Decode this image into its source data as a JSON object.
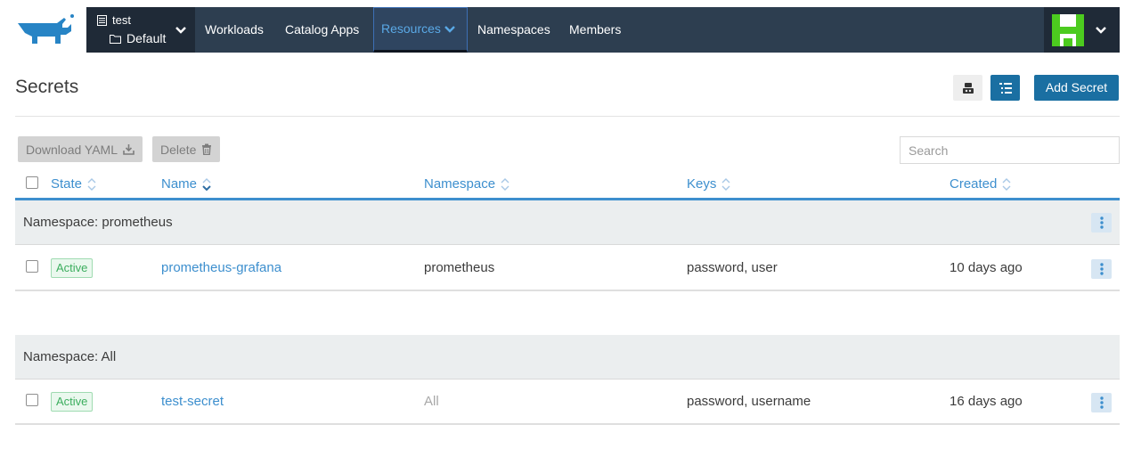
{
  "nav": {
    "cluster": "test",
    "project": "Default",
    "items": [
      {
        "label": "Workloads"
      },
      {
        "label": "Catalog Apps"
      },
      {
        "label": "Resources"
      },
      {
        "label": "Namespaces"
      },
      {
        "label": "Members"
      }
    ],
    "active_item": "Resources"
  },
  "page": {
    "title": "Secrets",
    "add_button": "Add Secret"
  },
  "toolbar": {
    "download_label": "Download YAML",
    "delete_label": "Delete",
    "search_placeholder": "Search"
  },
  "table": {
    "columns": [
      {
        "label": "State"
      },
      {
        "label": "Name"
      },
      {
        "label": "Namespace"
      },
      {
        "label": "Keys"
      },
      {
        "label": "Created"
      }
    ],
    "sorted_column": "Name",
    "groups": [
      {
        "label": "Namespace: prometheus",
        "rows": [
          {
            "state": "Active",
            "name": "prometheus-grafana",
            "namespace": "prometheus",
            "keys": "password, user",
            "created": "10 days ago"
          }
        ]
      },
      {
        "label": "Namespace: All",
        "rows": [
          {
            "state": "Active",
            "name": "test-secret",
            "namespace": "All",
            "keys": "password, username",
            "created": "16 days ago"
          }
        ]
      }
    ]
  },
  "colors": {
    "nav_bg": "#2d3e50",
    "nav_dark": "#1f2a37",
    "primary": "#1a6fa2",
    "link": "#3d8fce",
    "active_badge": "#3cae5e",
    "avatar_green": "#4ccb1f"
  },
  "icons": {
    "logo": "rancher-cow-logo",
    "cluster": "cluster-icon",
    "project": "folder-icon",
    "download": "download-icon",
    "delete": "trash-icon",
    "user": "identicon-avatar",
    "row_actions": "kebab-menu-icon"
  }
}
